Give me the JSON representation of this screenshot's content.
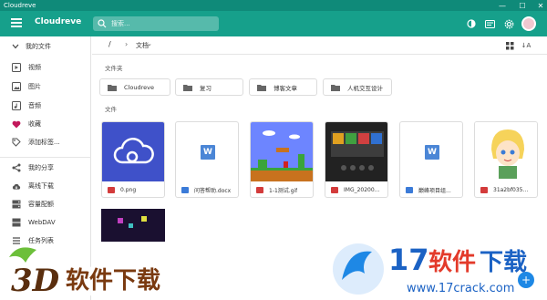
{
  "window": {
    "title": "Cloudreve"
  },
  "appbar": {
    "title": "Cloudreve",
    "search_placeholder": "搜索..."
  },
  "sidebar": {
    "root_label": "我的文件",
    "items": [
      {
        "label": "视频",
        "icon": "video-icon"
      },
      {
        "label": "图片",
        "icon": "image-icon"
      },
      {
        "label": "音频",
        "icon": "audio-icon"
      },
      {
        "label": "收藏",
        "icon": "heart-icon"
      },
      {
        "label": "添加标签...",
        "icon": "tag-icon"
      }
    ],
    "bottom_items": [
      {
        "label": "我的分享",
        "icon": "share-icon"
      },
      {
        "label": "离线下载",
        "icon": "cloud-download-icon"
      },
      {
        "label": "容量配额",
        "icon": "storage-icon"
      },
      {
        "label": "WebDAV",
        "icon": "webdav-icon"
      },
      {
        "label": "任务列表",
        "icon": "task-list-icon"
      }
    ]
  },
  "breadcrumb": {
    "root": "/",
    "current": "文档"
  },
  "sections": {
    "folders_label": "文件夹",
    "files_label": "文件"
  },
  "folders": [
    "Cloudreve",
    "复习",
    "博客文章",
    "人机交互设计"
  ],
  "files": [
    {
      "name": "0.png",
      "type": "image"
    },
    {
      "name": "问答帮助.docx",
      "type": "doc"
    },
    {
      "name": "1-1测试.gif",
      "type": "image"
    },
    {
      "name": "IMG_20200...",
      "type": "image"
    },
    {
      "name": "巅峰项目组...",
      "type": "doc"
    },
    {
      "name": "31a2bf035...",
      "type": "image"
    }
  ],
  "colors": {
    "primary": "#16a08b",
    "titlebar": "#0f8a79",
    "accent": "#1e88e5"
  },
  "watermark_left": "3D软件下载",
  "watermark_right": {
    "brand": "17软件下载",
    "url": "www.17crack.com"
  }
}
